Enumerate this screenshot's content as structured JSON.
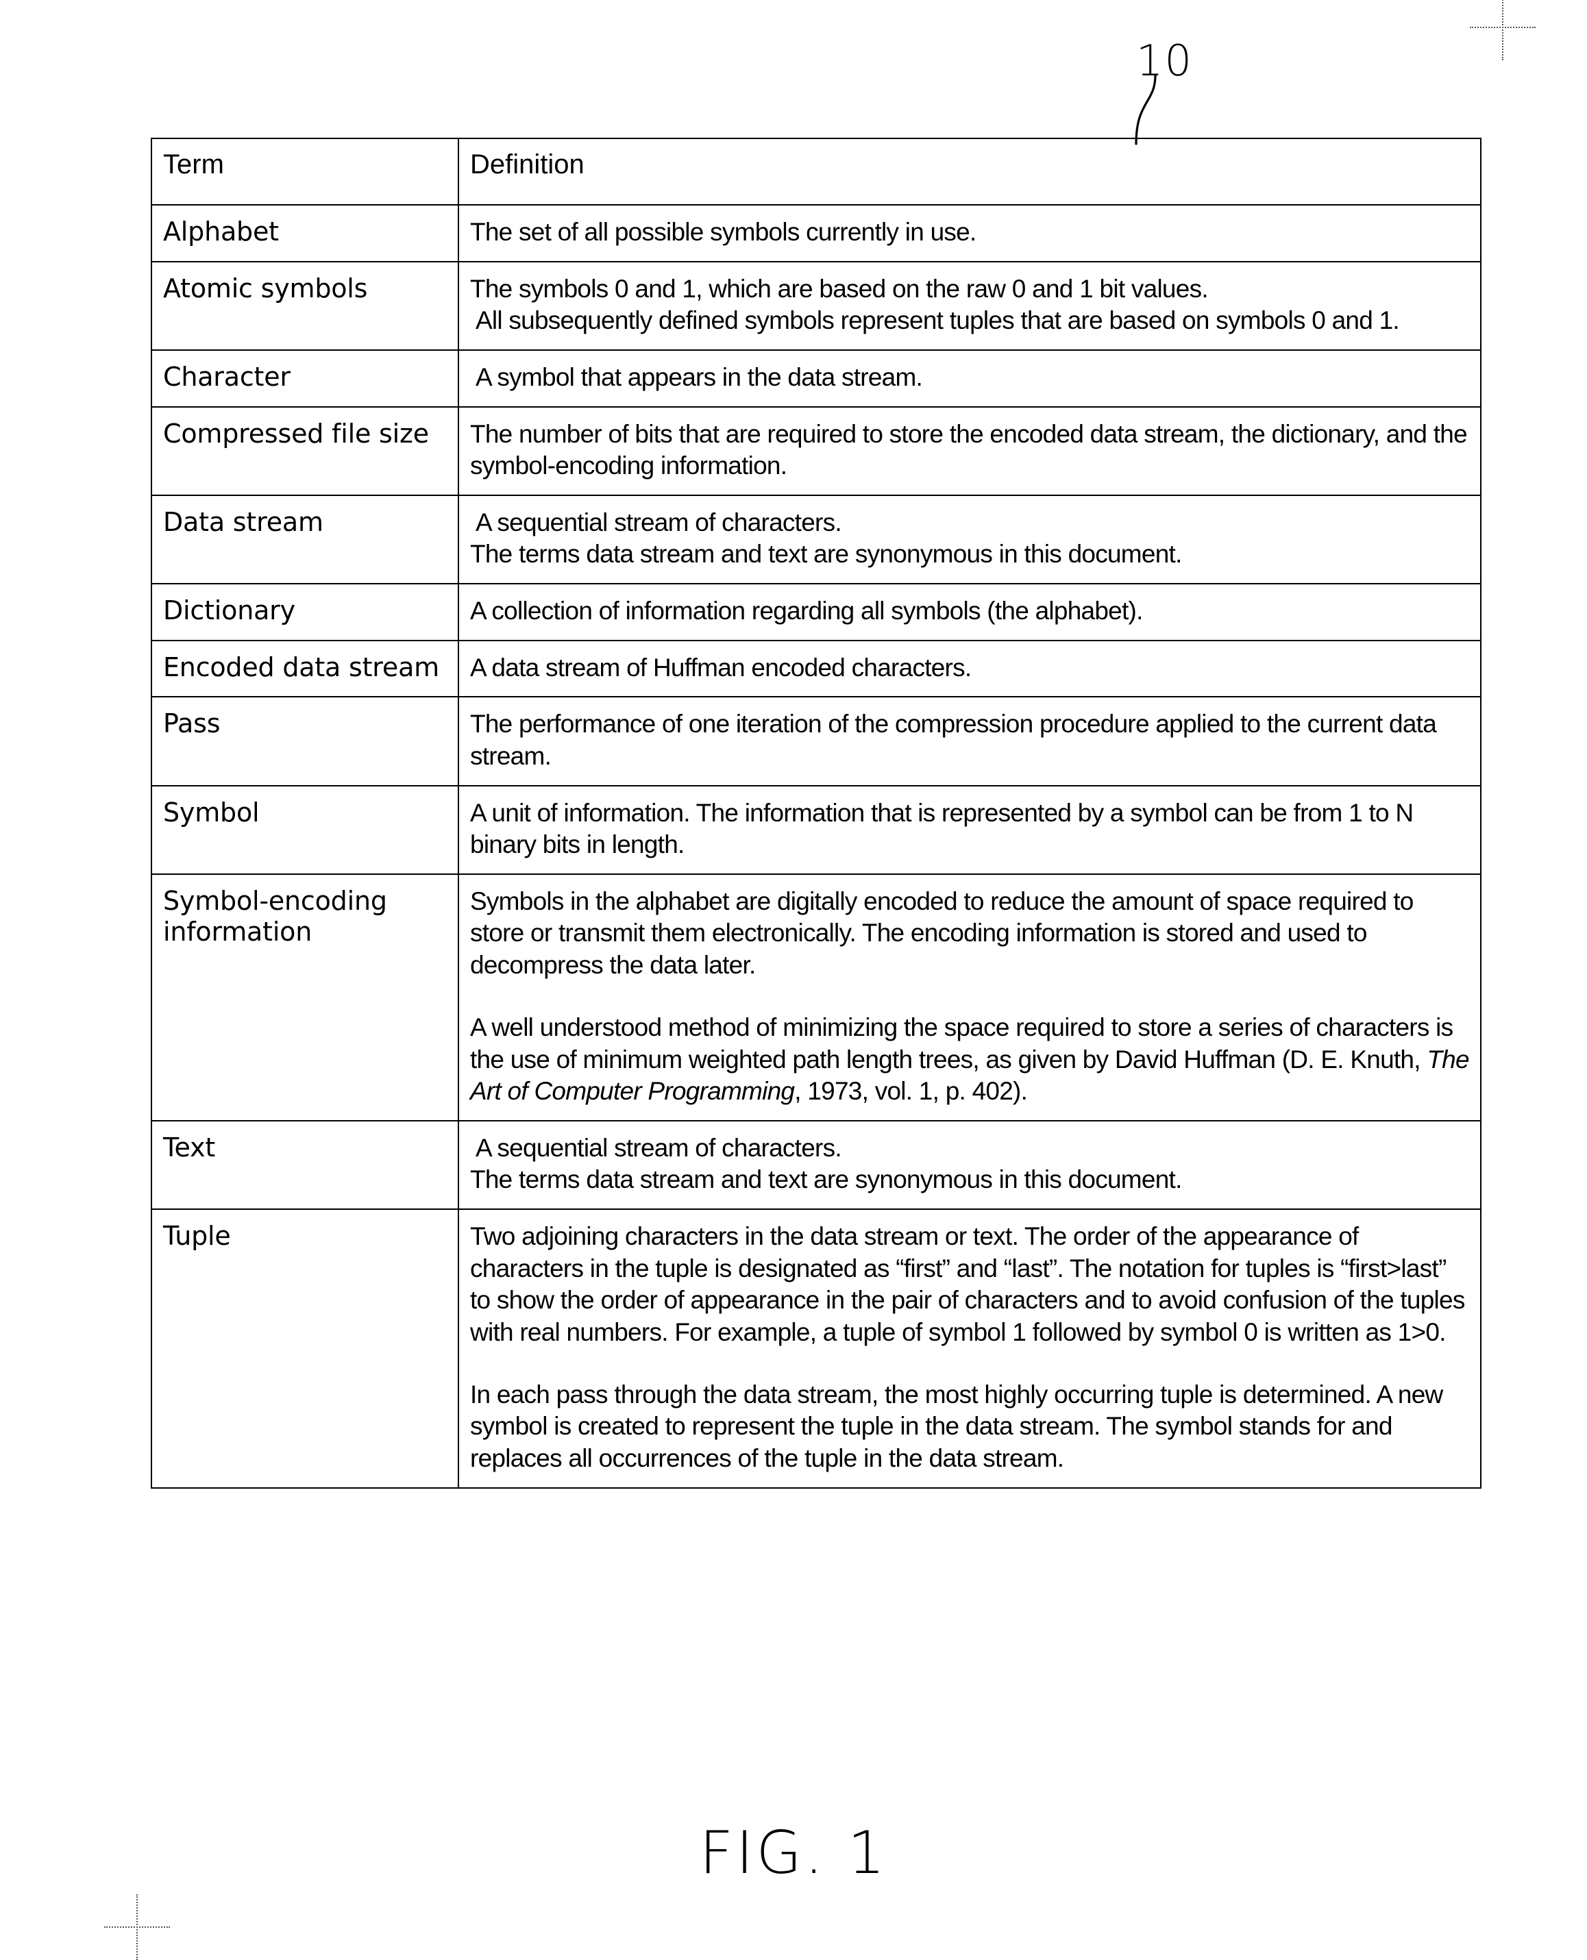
{
  "figure": {
    "reference_numeral": "10",
    "caption": "FIG. 1"
  },
  "table": {
    "headers": {
      "term": "Term",
      "definition": "Definition"
    },
    "rows": [
      {
        "term": "Alphabet",
        "definition_blocks": [
          {
            "text": "The set of all possible symbols currently in use.",
            "indented": false,
            "tight": false
          }
        ]
      },
      {
        "term": "Atomic symbols",
        "definition_blocks": [
          {
            "text": "The symbols 0 and 1, which are based on the raw 0 and 1 bit values.",
            "indented": false,
            "tight": true
          },
          {
            "text": "All subsequently defined symbols represent tuples that are based on symbols 0 and 1.",
            "indented": true,
            "tight": true
          }
        ]
      },
      {
        "term": "Character",
        "definition_blocks": [
          {
            "text": "A symbol that appears in the data stream.",
            "indented": true,
            "tight": false
          }
        ]
      },
      {
        "term": "Compressed file size",
        "definition_blocks": [
          {
            "text": "The number of bits that are required to store the encoded data stream, the dictionary, and the symbol-encoding information.",
            "indented": false,
            "tight": false
          }
        ]
      },
      {
        "term": "Data stream",
        "definition_blocks": [
          {
            "text": "A sequential stream of characters.",
            "indented": true,
            "tight": true
          },
          {
            "text": "The terms data stream and text are synonymous in this document.",
            "indented": false,
            "tight": true
          }
        ]
      },
      {
        "term": "Dictionary",
        "definition_blocks": [
          {
            "text": "A collection of information regarding all symbols (the alphabet).",
            "indented": false,
            "tight": false
          }
        ]
      },
      {
        "term": "Encoded data stream",
        "definition_blocks": [
          {
            "text": "A data stream of Huffman encoded characters.",
            "indented": false,
            "tight": false
          }
        ]
      },
      {
        "term": "Pass",
        "definition_blocks": [
          {
            "text": "The performance of one iteration of the compression procedure applied to the current data stream.",
            "indented": false,
            "tight": false
          }
        ]
      },
      {
        "term": "Symbol",
        "definition_blocks": [
          {
            "text": "A unit of information. The information that is represented by a symbol can be from 1 to N binary bits in length.",
            "indented": false,
            "tight": false
          }
        ]
      },
      {
        "term": "Symbol-encoding\ninformation",
        "definition_blocks": [
          {
            "text": "Symbols in the alphabet are digitally encoded to reduce the amount of space required to store or transmit them electronically. The encoding information is stored and used to decompress the data later.",
            "indented": false,
            "tight": false
          },
          {
            "html": "A well understood method of minimizing the space required to store a series of characters is the use of minimum weighted path length trees, as given by David Huffman (D. E. Knuth, <i>The Art of Computer Programming</i>, 1973, vol. 1, p. 402).",
            "indented": false,
            "tight": false
          }
        ]
      },
      {
        "term": "Text",
        "definition_blocks": [
          {
            "text": "A sequential stream of characters.",
            "indented": true,
            "tight": true
          },
          {
            "text": "The terms data stream and text are synonymous in this document.",
            "indented": false,
            "tight": true
          }
        ]
      },
      {
        "term": "Tuple",
        "definition_blocks": [
          {
            "text": "Two adjoining characters in the data stream or text. The order of the appearance of characters in the tuple is designated as “first” and “last”. The notation for tuples is “first>last” to show the order of appearance in the pair of characters and to avoid confusion of the tuples with real numbers. For example, a tuple of symbol 1 followed by symbol 0 is written as 1>0.",
            "indented": false,
            "tight": false
          },
          {
            "text": "In each pass through the data stream, the most highly occurring tuple is determined. A new symbol is created to represent the tuple in the data stream. The symbol stands for and replaces all occurrences of the tuple in the data stream.",
            "indented": false,
            "tight": false
          }
        ]
      }
    ]
  }
}
